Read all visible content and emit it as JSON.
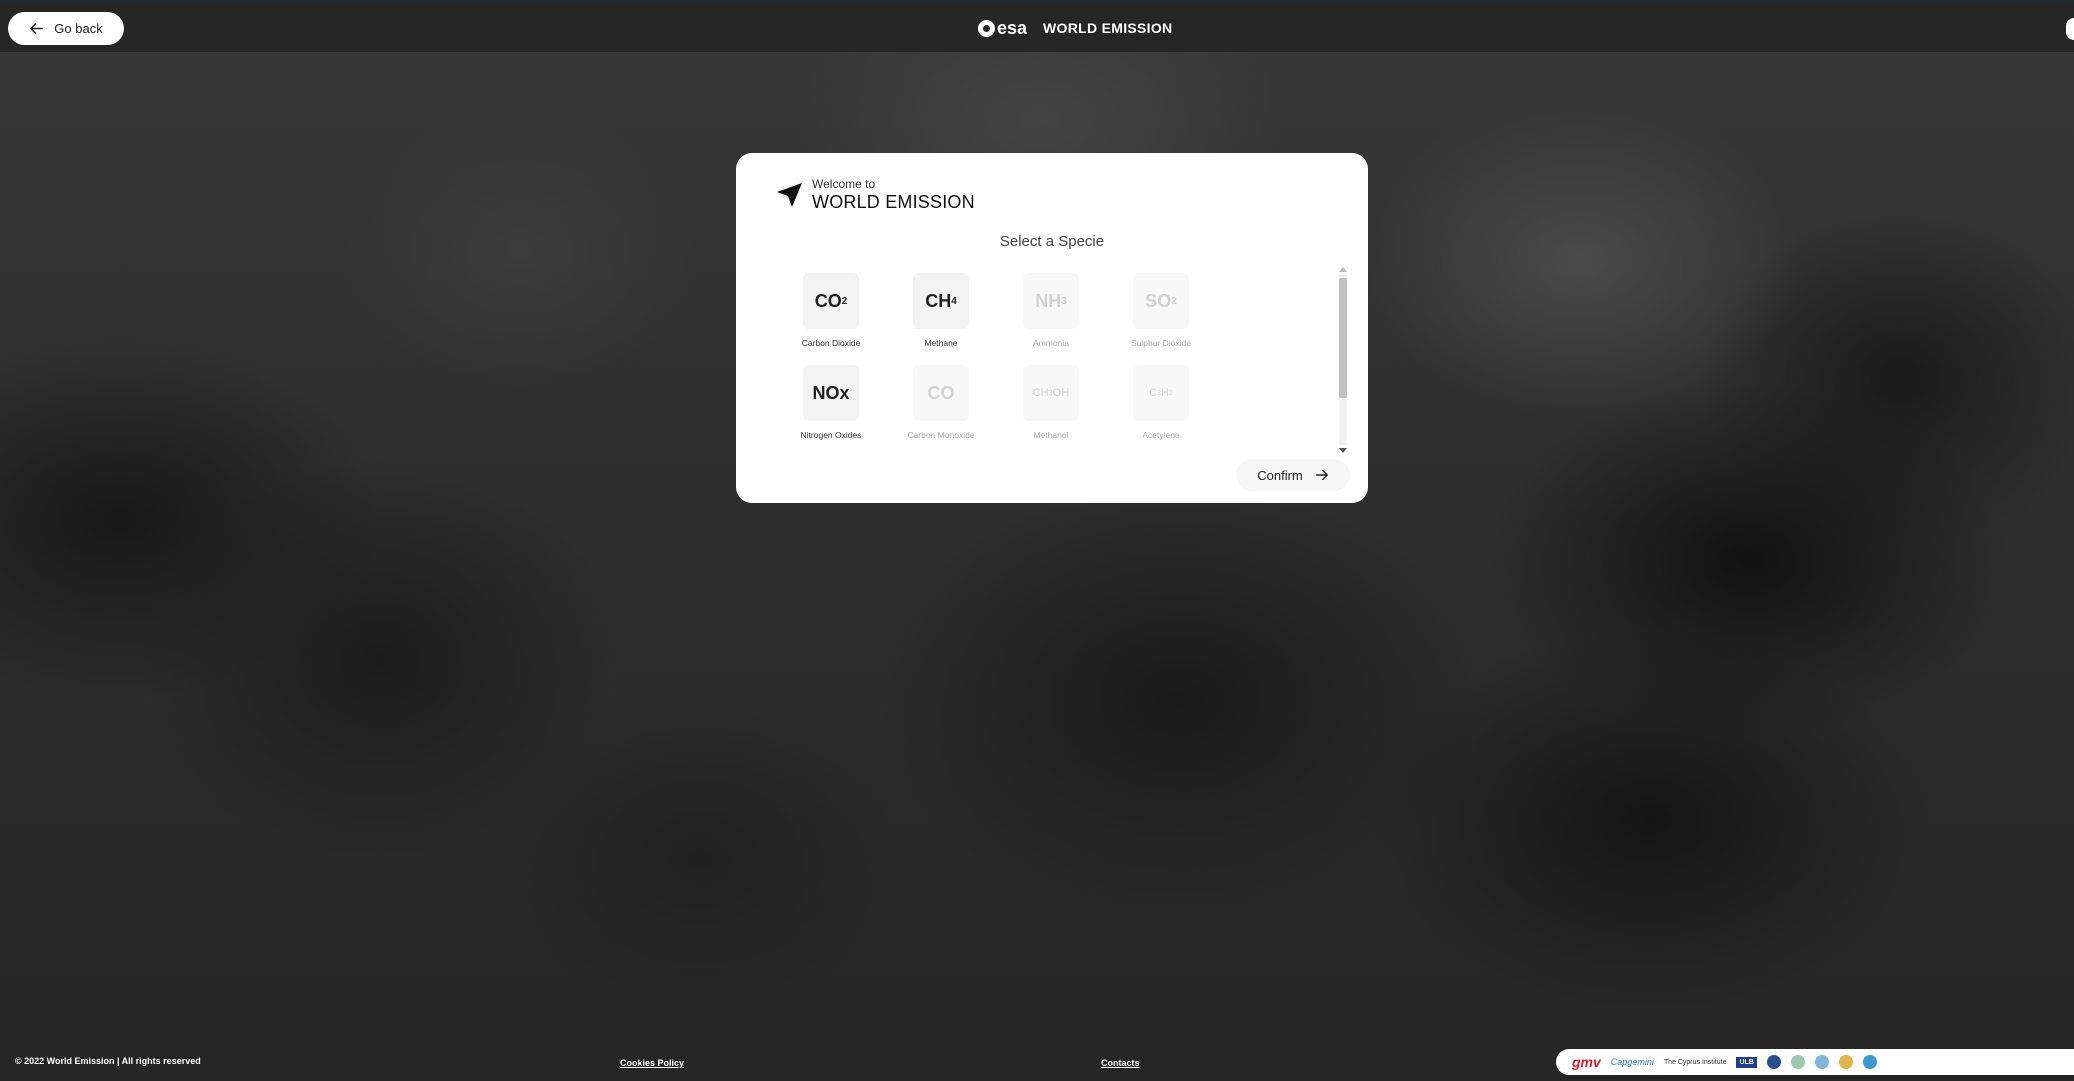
{
  "topbar": {
    "go_back_label": "Go back",
    "logo_text": "esa",
    "app_title": "WORLD EMISSION"
  },
  "modal": {
    "welcome_small": "Welcome to",
    "welcome_big": "WORLD EMISSION",
    "select_title": "Select a Specie",
    "confirm_label": "Confirm",
    "species": [
      {
        "formula": "CO",
        "sub": "2",
        "label": "Carbon Dioxide",
        "enabled": true
      },
      {
        "formula": "CH",
        "sub": "4",
        "label": "Methane",
        "enabled": true
      },
      {
        "formula": "NH",
        "sub": "3",
        "label": "Ammonia",
        "enabled": false
      },
      {
        "formula": "SO",
        "sub": "2",
        "label": "Sulphur Dioxide",
        "enabled": false
      },
      {
        "formula": "NOx",
        "sub": "",
        "label": "Nitrogen Oxides",
        "enabled": true
      },
      {
        "formula": "CO",
        "sub": "",
        "label": "Carbon Monoxide",
        "enabled": false
      },
      {
        "formula": "CH",
        "sub": "3",
        "tail": "OH",
        "label": "Methanol",
        "enabled": false
      },
      {
        "formula": "C",
        "sub": "2",
        "tail": "H",
        "sub2": "2",
        "label": "Acetylene",
        "enabled": false
      }
    ]
  },
  "footer": {
    "copyright": "© 2022 World Emission | All rights reserved",
    "cookies_label": "Cookies Policy",
    "contacts_label": "Contacts",
    "partners": {
      "gmv": "gmv",
      "capgemini": "Capgemini",
      "cyprus": "The Cyprus Institute",
      "ulb": "ULB"
    }
  },
  "colors": {
    "topbar_bg": "#262626",
    "modal_bg": "#ffffff",
    "disabled_text": "#d2d2d2"
  }
}
